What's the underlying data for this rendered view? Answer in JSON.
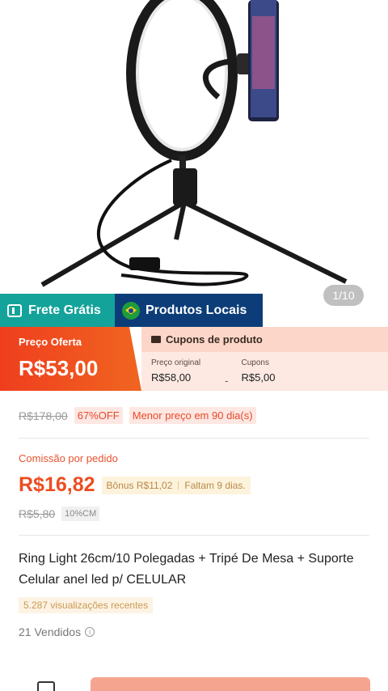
{
  "gallery": {
    "counter": "1/10"
  },
  "badges": {
    "free_shipping": "Frete Grátis",
    "local_products": "Produtos Locais"
  },
  "offer": {
    "label": "Preço Oferta",
    "price": "R$53,00"
  },
  "coupons": {
    "header": "Cupons de produto",
    "original_label": "Preço original",
    "original_value": "R$58,00",
    "minus": "-",
    "coupon_label": "Cupons",
    "coupon_value": "R$5,00"
  },
  "pricing": {
    "old_price": "R$178,00",
    "discount": "67%OFF",
    "lowest_note": "Menor preço em 90 dia(s)"
  },
  "commission": {
    "label": "Comissão por pedido",
    "amount": "R$16,82",
    "bonus": "Bônus R$11,02",
    "days_left": "Faltam 9 dias.",
    "old_commission": "R$5,80",
    "rate": "10%CM"
  },
  "product": {
    "title": "Ring Light 26cm/10 Polegadas + Tripé De Mesa + Suporte Celular anel led p/ CELULAR",
    "views": "5.287 visualizações recentes",
    "sold": "21 Vendidos",
    "info_glyph": "i"
  },
  "colors": {
    "accent": "#ef3e1e",
    "teal": "#14a39a",
    "navy": "#0c3d78"
  }
}
